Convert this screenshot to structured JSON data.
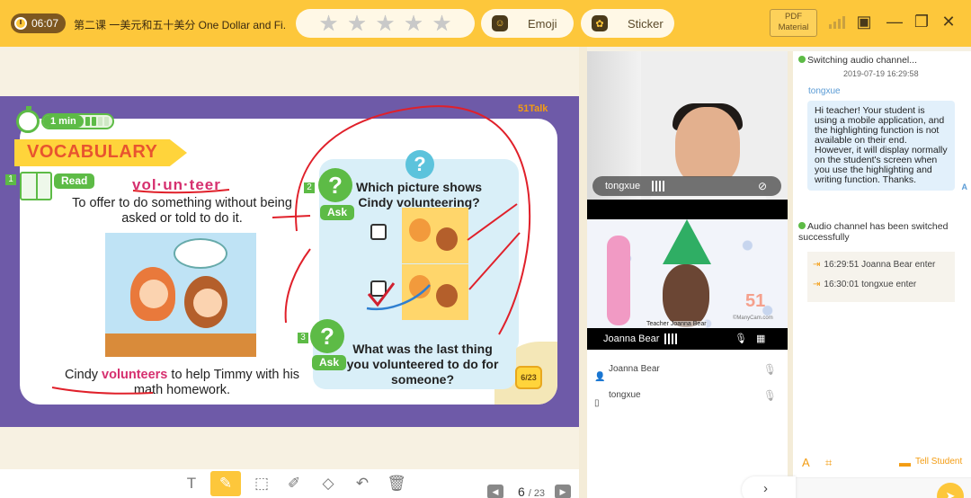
{
  "header": {
    "timer": "06:07",
    "lesson_title": "第二课 一美元和五十美分 One Dollar and Fi...",
    "rating_stars": 5,
    "emoji_label": "Emoji",
    "sticker_label": "Sticker",
    "pdf_label_line1": "PDF",
    "pdf_label_line2": "Material",
    "brand_color": "#fdc73b"
  },
  "slide": {
    "brand": "51Talk",
    "timer_label": "1 min",
    "section_title": "VOCABULARY",
    "step1": "1",
    "step2": "2",
    "step3": "3",
    "read_label": "Read",
    "ask_label": "Ask",
    "word": "vol·un·teer",
    "definition": "To offer to do something without being asked or told to do it.",
    "sentence_before": "Cindy ",
    "sentence_highlight": "volunteers",
    "sentence_after": " to help Timmy with his math homework.",
    "question1": "Which picture shows Cindy volunteering?",
    "question2": "What was the last thing you volunteered to do for someone?",
    "page_badge": "6/23",
    "option1_checked": false,
    "option2_checked": true
  },
  "toolbar": {
    "tools": [
      "text-tool",
      "pen-tool",
      "select-tool",
      "highlighter-tool",
      "eraser-tool",
      "undo-tool",
      "clear-tool"
    ],
    "active_tool": "pen-tool",
    "current_page": "6",
    "page_separator": "/",
    "total_pages": "23"
  },
  "videos": {
    "student_name": "tongxue",
    "teacher_name": "Joanna Bear",
    "teacher_overlay": "Teacher Joanna Bear",
    "watermark": "51",
    "teacher_caption": "©ManyCam.com"
  },
  "participants": [
    {
      "name": "Joanna Bear",
      "role": "teacher"
    },
    {
      "name": "tongxue",
      "role": "student"
    }
  ],
  "chat": {
    "sys1": "Switching audio channel...",
    "time1": "2019-07-19 16:29:58",
    "sender": "tongxue",
    "message": "Hi teacher! Your student is using a mobile application, and the highlighting function is not available on their end. However, it will display normally on the student's screen when you use the highlighting and writing function. Thanks.",
    "translate_icon": "A",
    "sys2": "Audio channel has been switched successfully",
    "log1": "16:29:51 Joanna Bear enter",
    "log2": "16:30:01 tongxue enter",
    "tell_student": "Tell Student"
  }
}
